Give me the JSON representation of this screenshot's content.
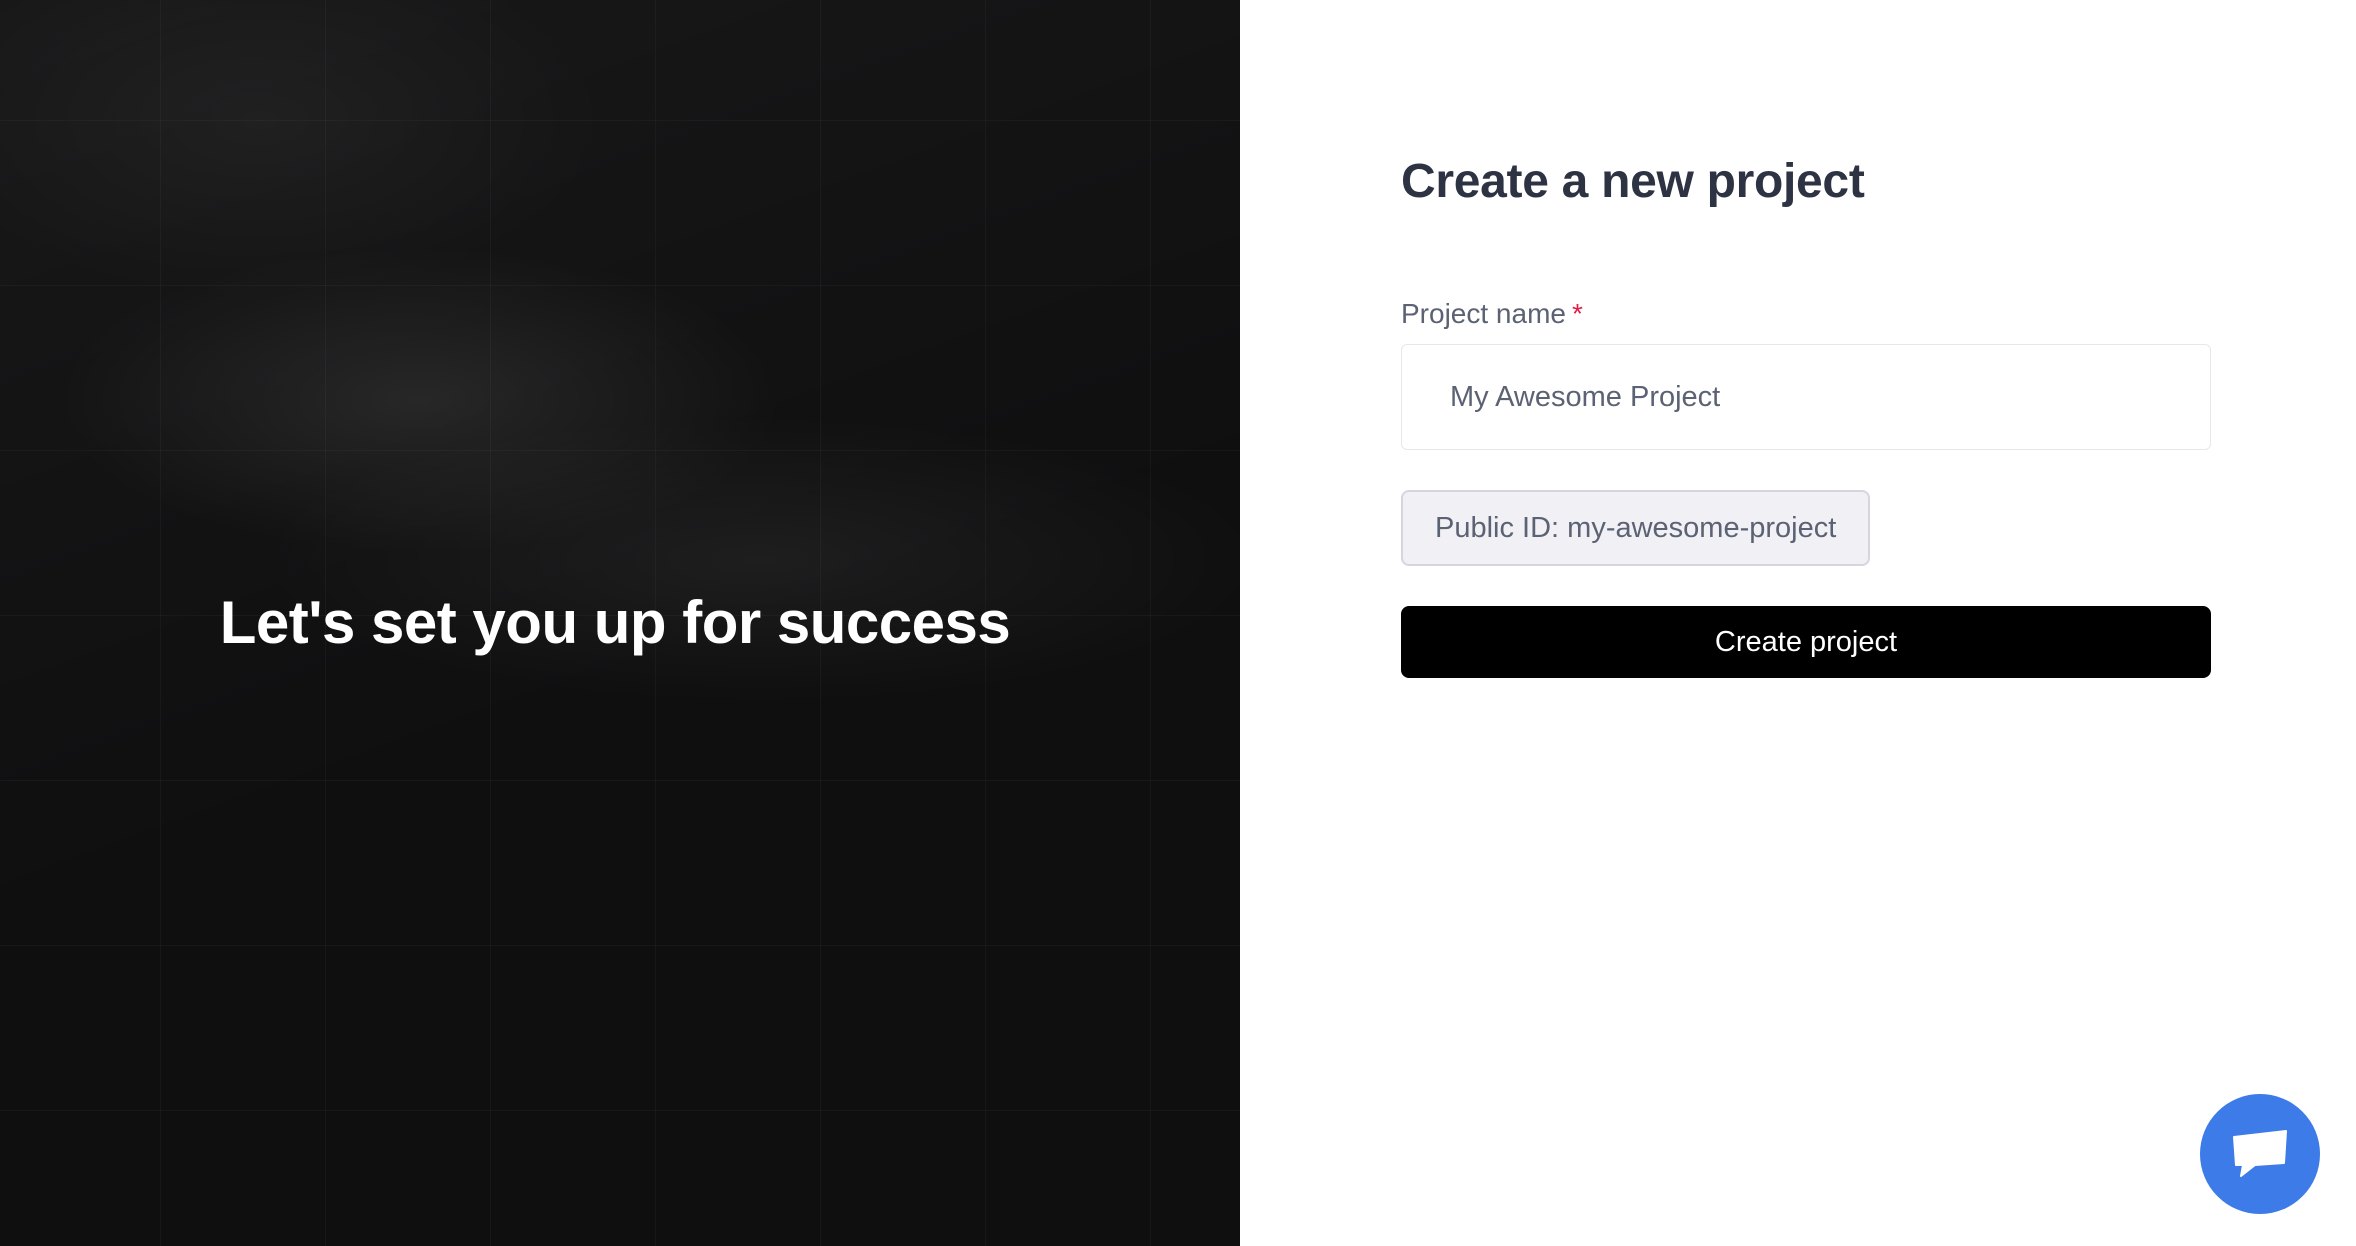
{
  "hero": {
    "title": "Let's set you up for success"
  },
  "form": {
    "title": "Create a new project",
    "project_name_label": "Project name",
    "required_mark": "*",
    "project_name_value": "My Awesome Project",
    "public_id_text": "Public ID: my-awesome-project",
    "submit_label": "Create project"
  },
  "chat": {
    "icon": "chat-bubble-icon",
    "color": "#3d7be8"
  },
  "colors": {
    "hero_background": "#0f0f10",
    "button_background": "#000000",
    "required": "#e11d48"
  }
}
